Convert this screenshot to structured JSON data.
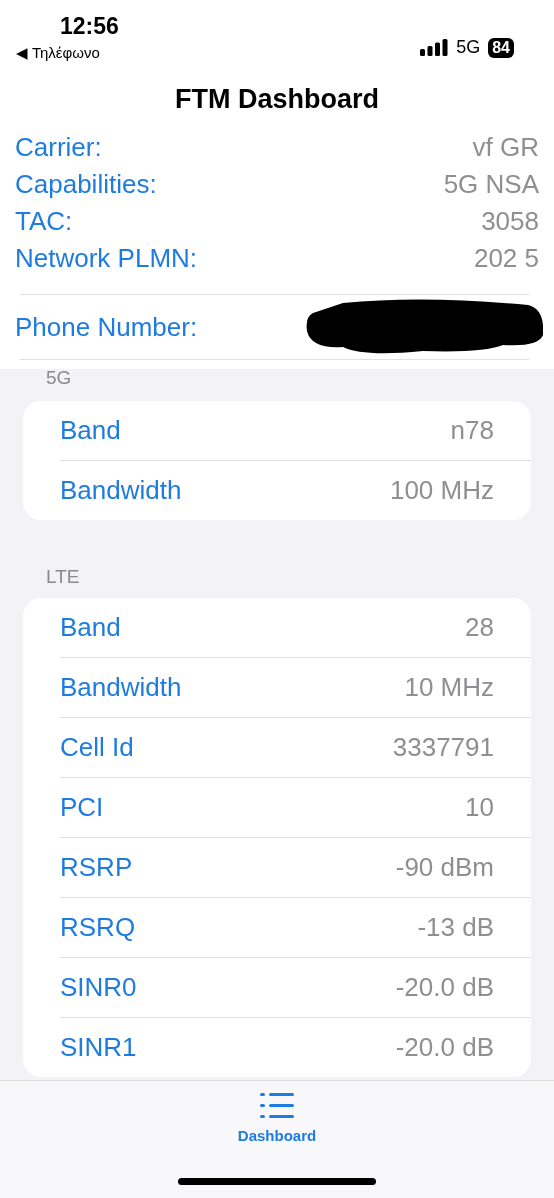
{
  "status_bar": {
    "time": "12:56",
    "back_label": "◀ Τηλέφωνο",
    "network": "5G",
    "battery": "84"
  },
  "title": "FTM Dashboard",
  "info": [
    {
      "label": "Carrier:",
      "value": "vf GR"
    },
    {
      "label": "Capabilities:",
      "value": "5G NSA"
    },
    {
      "label": "TAC:",
      "value": "3058"
    },
    {
      "label": "Network PLMN:",
      "value": "202 5"
    }
  ],
  "phone": {
    "label": "Phone Number:",
    "redacted": true
  },
  "sections": [
    {
      "header": "5G",
      "rows": [
        {
          "label": "Band",
          "value": "n78"
        },
        {
          "label": "Bandwidth",
          "value": "100 MHz"
        }
      ]
    },
    {
      "header": "LTE",
      "rows": [
        {
          "label": "Band",
          "value": "28"
        },
        {
          "label": "Bandwidth",
          "value": "10 MHz"
        },
        {
          "label": "Cell Id",
          "value": "3337791"
        },
        {
          "label": "PCI",
          "value": "10"
        },
        {
          "label": "RSRP",
          "value": "-90 dBm"
        },
        {
          "label": "RSRQ",
          "value": "-13 dB"
        },
        {
          "label": "SINR0",
          "value": "-20.0 dB"
        },
        {
          "label": "SINR1",
          "value": "-20.0 dB"
        }
      ]
    }
  ],
  "tabs": [
    {
      "label": "Dashboard",
      "selected": true
    }
  ]
}
